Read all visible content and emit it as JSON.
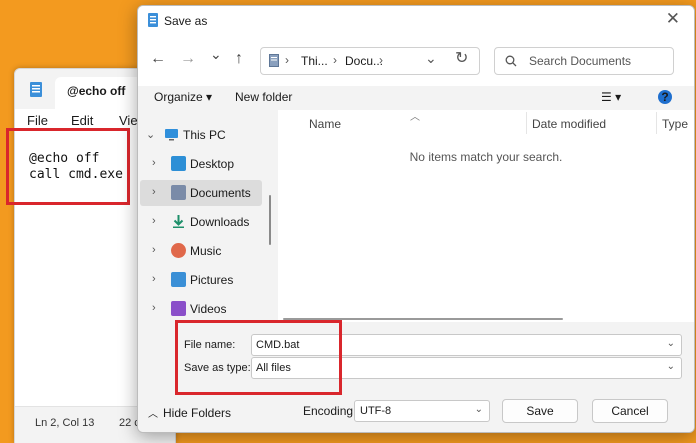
{
  "notepad": {
    "tab_title": "@echo off",
    "menu": {
      "file": "File",
      "edit": "Edit",
      "view": "Vie"
    },
    "code_lines": [
      "@echo off",
      "call cmd.exe"
    ],
    "status": {
      "position": "Ln 2, Col 13",
      "chars": "22 c"
    }
  },
  "dialog": {
    "title": "Save as",
    "close_glyph": "✕",
    "nav": {
      "back": "←",
      "forward": "→",
      "recent": "⌄",
      "up": "↑"
    },
    "address": {
      "crumb1": "Thi...",
      "crumb2": "Docu...",
      "sep": "›",
      "dropdown": "⌄",
      "refresh": "↻"
    },
    "search": {
      "placeholder": "Search Documents"
    },
    "commandbar": {
      "organize": "Organize ▾",
      "new_folder": "New folder",
      "view_menu": "☰ ▾",
      "help": "?"
    },
    "tree": {
      "this_pc": "This PC",
      "items": [
        {
          "label": "Desktop",
          "icon": "desktop-icon",
          "color": "#2d8fd6"
        },
        {
          "label": "Documents",
          "icon": "documents-icon",
          "color": "#7a8ba8",
          "selected": true
        },
        {
          "label": "Downloads",
          "icon": "downloads-icon",
          "color": "#1d8f6a"
        },
        {
          "label": "Music",
          "icon": "music-icon",
          "color": "#e0684a"
        },
        {
          "label": "Pictures",
          "icon": "pictures-icon",
          "color": "#3a8fd6"
        },
        {
          "label": "Videos",
          "icon": "videos-icon",
          "color": "#8a4fc9"
        }
      ]
    },
    "columns": {
      "name": "Name",
      "date_modified": "Date modified",
      "type": "Type"
    },
    "empty_message": "No items match your search.",
    "file_name_label": "File name:",
    "file_name_value": "CMD.bat",
    "save_type_label": "Save as type:",
    "save_type_value": "All files",
    "hide_folders": "Hide Folders",
    "encoding_label": "Encoding:",
    "encoding_value": "UTF-8",
    "save_button": "Save",
    "cancel_button": "Cancel"
  },
  "colors": {
    "background": "#f39a1f",
    "highlight_box": "#d9262c",
    "accent": "#1f6fce"
  }
}
